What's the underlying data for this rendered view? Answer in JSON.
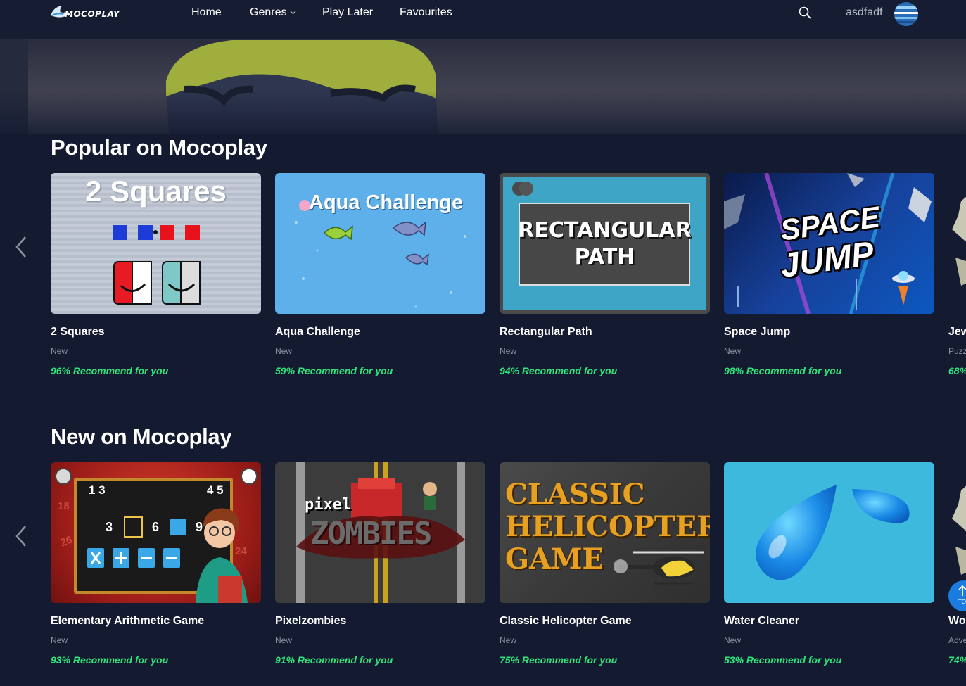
{
  "nav": {
    "logo_text": "MOCOPLAY",
    "links": [
      {
        "label": "Home"
      },
      {
        "label": "Genres"
      },
      {
        "label": "Play Later"
      },
      {
        "label": "Favourites"
      }
    ],
    "username": "asdfadf"
  },
  "sections": [
    {
      "title": "Popular on Mocoplay",
      "cards": [
        {
          "title": "2 Squares",
          "tag": "New",
          "rec": "96% Recommend for you",
          "thumb_text": "2 Squares"
        },
        {
          "title": "Aqua Challenge",
          "tag": "New",
          "rec": "59% Recommend for you",
          "thumb_text": "Aqua Challenge"
        },
        {
          "title": "Rectangular Path",
          "tag": "New",
          "rec": "94% Recommend for you",
          "thumb_text_1": "RECTANGULAR",
          "thumb_text_2": "PATH"
        },
        {
          "title": "Space Jump",
          "tag": "New",
          "rec": "98% Recommend for you",
          "thumb_text_1": "SPACE",
          "thumb_text_2": "JUMP"
        },
        {
          "title": "Jew",
          "tag": "Puzz",
          "rec": "68%"
        }
      ]
    },
    {
      "title": "New on Mocoplay",
      "cards": [
        {
          "title": "Elementary Arithmetic Game",
          "tag": "New",
          "rec": "93% Recommend for you",
          "thumb_nums_1": "1 3",
          "thumb_nums_2": "4 5",
          "thumb_row_a": "3",
          "thumb_row_b": "6",
          "thumb_row_c": "9",
          "thumb_side_1": "18",
          "thumb_side_2": "26",
          "thumb_side_3": "24"
        },
        {
          "title": "Pixelzombies",
          "tag": "New",
          "rec": "91% Recommend for you",
          "thumb_text_1": "pixel",
          "thumb_text_2": "ZOMBIES"
        },
        {
          "title": "Classic Helicopter Game",
          "tag": "New",
          "rec": "75% Recommend for you",
          "thumb_text_1": "CLASSIC",
          "thumb_text_2": "HELICOPTER",
          "thumb_text_3": "GAME"
        },
        {
          "title": "Water Cleaner",
          "tag": "New",
          "rec": "53% Recommend for you"
        },
        {
          "title": "Wor",
          "tag": "Adve",
          "rec": "74%"
        }
      ]
    }
  ],
  "to_top_label": "TO",
  "colors": {
    "background": "#141b31",
    "nav": "#161d33",
    "recommend": "#2ee57a",
    "tag": "#8c92a2",
    "to_top": "#1a7be0"
  },
  "icons": [
    "logo-shark-icon",
    "chevron-down-icon",
    "search-icon",
    "avatar-icon",
    "chevron-left-icon",
    "arrow-up-icon"
  ]
}
